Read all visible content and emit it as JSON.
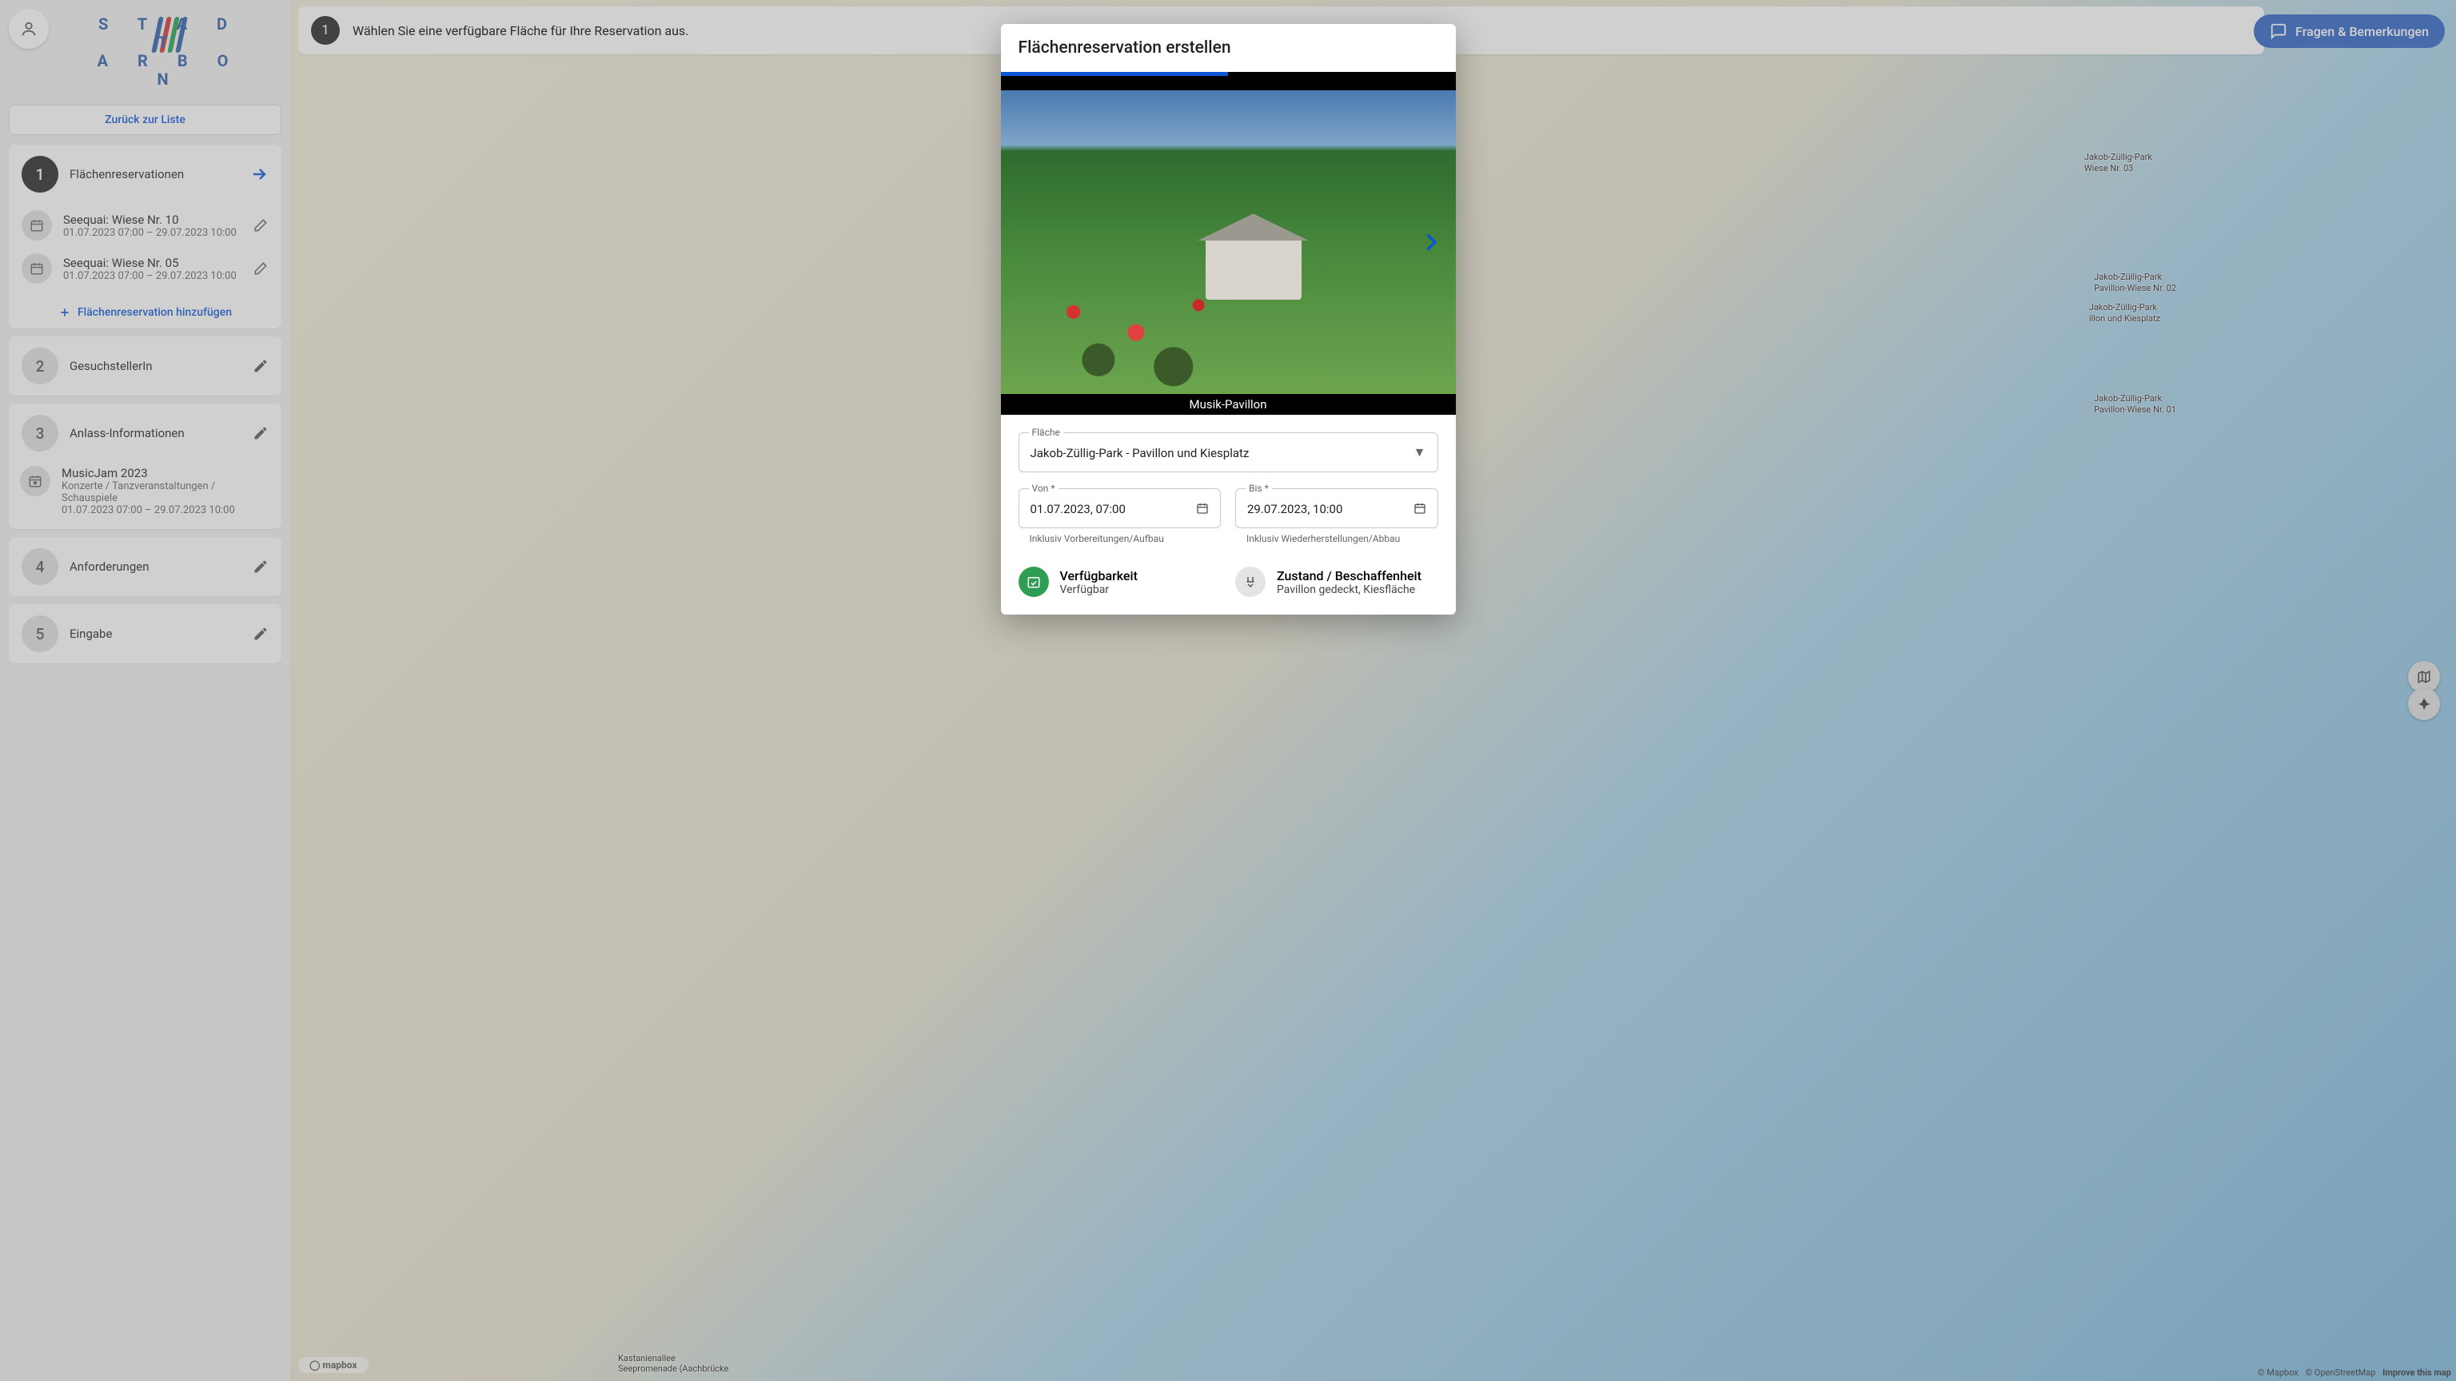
{
  "logo": {
    "line1": "S T A D T",
    "line2": "A R B O N"
  },
  "sidebar": {
    "back_label": "Zurück zur Liste",
    "steps": [
      {
        "num": "1",
        "title": "Flächenreservationen",
        "active": true
      },
      {
        "num": "2",
        "title": "GesuchstellerIn"
      },
      {
        "num": "3",
        "title": "Anlass-Informationen"
      },
      {
        "num": "4",
        "title": "Anforderungen"
      },
      {
        "num": "5",
        "title": "Eingabe"
      }
    ],
    "reservations": [
      {
        "title": "Seequai: Wiese Nr. 10",
        "dates": "01.07.2023 07:00 – 29.07.2023 10:00"
      },
      {
        "title": "Seequai: Wiese Nr. 05",
        "dates": "01.07.2023 07:00 – 29.07.2023 10:00"
      }
    ],
    "add_label": "Flächenreservation hinzufügen",
    "event": {
      "title": "MusicJam 2023",
      "category": "Konzerte / Tanzveranstaltungen / Schauspiele",
      "dates": "01.07.2023 07:00 – 29.07.2023 10:00"
    }
  },
  "top_banner": {
    "num": "1",
    "text": "Wählen Sie eine verfügbare Fläche für Ihre Reservation aus."
  },
  "feedback": "Fragen & Bemerkungen",
  "map": {
    "labels": [
      {
        "l1": "Jakob-Züllig-Park",
        "l2": "Wiese Nr. 03"
      },
      {
        "l1": "Jakob-Züllig-Park",
        "l2": "Pavillon-Wiese Nr. 02"
      },
      {
        "l1": "Jakob-Züllig-Park",
        "l2": "illon und Kiesplatz"
      },
      {
        "l1": "Jakob-Züllig-Park",
        "l2": "Pavillon-Wiese Nr. 01"
      },
      {
        "l1": "Kastanienallee",
        "l2": "Seepromenade (Aachbrücke"
      }
    ],
    "badge": "mapbox",
    "credits": {
      "c1": "© Mapbox",
      "c2": "© OpenStreetMap",
      "c3": "Improve this map"
    }
  },
  "modal": {
    "title": "Flächenreservation erstellen",
    "image_caption": "Musik-Pavillon",
    "flaeche_label": "Fläche",
    "flaeche_value": "Jakob-Züllig-Park - Pavillon und Kiesplatz",
    "von_label": "Von *",
    "von_value": "01.07.2023, 07:00",
    "von_hint": "Inklusiv Vorbereitungen/Aufbau",
    "bis_label": "Bis *",
    "bis_value": "29.07.2023, 10:00",
    "bis_hint": "Inklusiv Wiederherstellungen/Abbau",
    "avail_title": "Verfügbarkeit",
    "avail_value": "Verfügbar",
    "cond_title": "Zustand / Beschaffenheit",
    "cond_value": "Pavillon gedeckt, Kiesfläche"
  }
}
